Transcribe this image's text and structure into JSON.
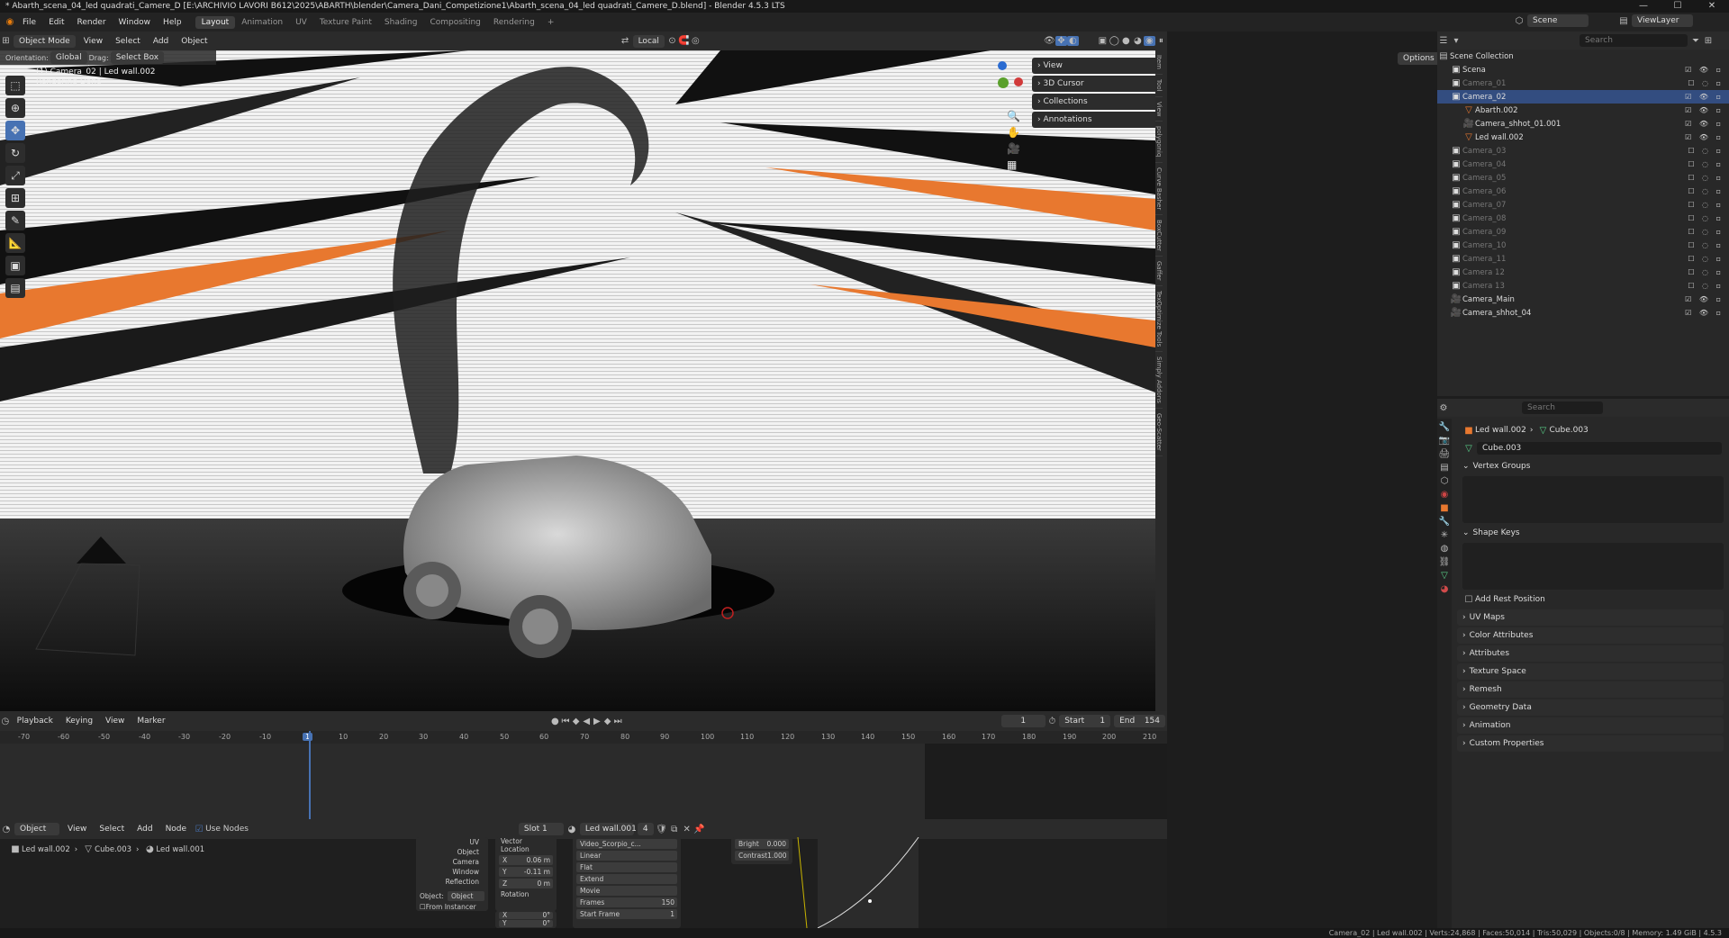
{
  "window": {
    "title": "* Abarth_scena_04_led quadrati_Camere_D [E:\\ARCHIVIO LAVORI B612\\2025\\ABARTH\\blender\\Camera_Dani_Competizione1\\Abarth_scena_04_led quadrati_Camere_D.blend] - Blender 4.5.3 LTS",
    "controls": [
      "—",
      "☐",
      "✕"
    ]
  },
  "menu": {
    "items": [
      "File",
      "Edit",
      "Render",
      "Window",
      "Help"
    ],
    "workspaces": [
      "Layout",
      "Animation",
      "UV",
      "Texture Paint",
      "Shading",
      "Compositing",
      "Rendering"
    ],
    "active_workspace": "Layout",
    "scene_label": "Scene",
    "viewlayer_label": "ViewLayer"
  },
  "viewport": {
    "mode": "Object Mode",
    "menus": [
      "View",
      "Select",
      "Add",
      "Object"
    ],
    "transform_space": "Local",
    "orientation_label": "Orientation:",
    "orientation_value": "Global",
    "drag_label": "Drag:",
    "drag_value": "Select Box",
    "options": "Options",
    "overlay_line1": "Camera Perspective",
    "overlay_line2": "(1) Camera_02 | Led wall.002",
    "overlay_line3": "Rendering Done"
  },
  "npanel": {
    "sections": [
      "View",
      "3D Cursor",
      "Collections",
      "Annotations"
    ],
    "tabs": [
      "Item",
      "Tool",
      "View",
      "polygoniq",
      "Curve Basher",
      "BoxCutter",
      "Gaffer",
      "TexOptimize Tools",
      "Simply Addons",
      "Geo-Scatter"
    ]
  },
  "outliner": {
    "search_placeholder": "Search",
    "root": "Scene Collection",
    "rows": [
      {
        "label": "Scena",
        "indent": 1,
        "dim": false,
        "sel": false,
        "type": "collection"
      },
      {
        "label": "Camera_01",
        "indent": 1,
        "dim": true,
        "sel": false,
        "type": "collection"
      },
      {
        "label": "Camera_02",
        "indent": 1,
        "dim": false,
        "sel": true,
        "type": "collection"
      },
      {
        "label": "Abarth.002",
        "indent": 2,
        "dim": false,
        "sel": false,
        "type": "object"
      },
      {
        "label": "Camera_shhot_01.001",
        "indent": 2,
        "dim": false,
        "sel": false,
        "type": "camera"
      },
      {
        "label": "Led wall.002",
        "indent": 2,
        "dim": false,
        "sel": false,
        "type": "object"
      },
      {
        "label": "Camera_03",
        "indent": 1,
        "dim": true,
        "sel": false,
        "type": "collection"
      },
      {
        "label": "Camera_04",
        "indent": 1,
        "dim": true,
        "sel": false,
        "type": "collection"
      },
      {
        "label": "Camera_05",
        "indent": 1,
        "dim": true,
        "sel": false,
        "type": "collection"
      },
      {
        "label": "Camera_06",
        "indent": 1,
        "dim": true,
        "sel": false,
        "type": "collection"
      },
      {
        "label": "Camera_07",
        "indent": 1,
        "dim": true,
        "sel": false,
        "type": "collection"
      },
      {
        "label": "Camera_08",
        "indent": 1,
        "dim": true,
        "sel": false,
        "type": "collection"
      },
      {
        "label": "Camera_09",
        "indent": 1,
        "dim": true,
        "sel": false,
        "type": "collection"
      },
      {
        "label": "Camera_10",
        "indent": 1,
        "dim": true,
        "sel": false,
        "type": "collection"
      },
      {
        "label": "Camera_11",
        "indent": 1,
        "dim": true,
        "sel": false,
        "type": "collection"
      },
      {
        "label": "Camera 12",
        "indent": 1,
        "dim": true,
        "sel": false,
        "type": "collection"
      },
      {
        "label": "Camera 13",
        "indent": 1,
        "dim": true,
        "sel": false,
        "type": "collection"
      },
      {
        "label": "Camera_Main",
        "indent": 1,
        "dim": false,
        "sel": false,
        "type": "camera"
      },
      {
        "label": "Camera_shhot_04",
        "indent": 1,
        "dim": false,
        "sel": false,
        "type": "camera"
      }
    ]
  },
  "properties": {
    "search_placeholder": "Search",
    "breadcrumb_object": "Led wall.002",
    "breadcrumb_mesh": "Cube.003",
    "mesh_name": "Cube.003",
    "vertex_groups": "Vertex Groups",
    "shape_keys": "Shape Keys",
    "add_rest_position": "Add Rest Position",
    "sections": [
      "UV Maps",
      "Color Attributes",
      "Attributes",
      "Texture Space",
      "Remesh",
      "Geometry Data",
      "Animation",
      "Custom Properties"
    ]
  },
  "timeline": {
    "menus": [
      "Playback",
      "Keying",
      "View",
      "Marker"
    ],
    "current_frame": "1",
    "start_label": "Start",
    "start": "1",
    "end_label": "End",
    "end": "154",
    "ticks": [
      "-70",
      "-60",
      "-50",
      "-40",
      "-30",
      "-20",
      "-10",
      "1",
      "10",
      "20",
      "30",
      "40",
      "50",
      "60",
      "70",
      "80",
      "90",
      "100",
      "110",
      "120",
      "130",
      "140",
      "150",
      "160",
      "170",
      "180",
      "190",
      "200",
      "210"
    ]
  },
  "node_editor": {
    "mode": "Object",
    "menus": [
      "View",
      "Select",
      "Add",
      "Node"
    ],
    "use_nodes": "Use Nodes",
    "slot": "Slot 1",
    "material": "Led wall.001",
    "users": "4",
    "breadcrumb": [
      "Led wall.002",
      "Cube.003",
      "Led wall.001"
    ],
    "texcoord": {
      "outputs": [
        "UV",
        "Object",
        "Camera",
        "Window",
        "Reflection"
      ],
      "object_label": "Object:",
      "object_placeholder": "Object",
      "from_instancer": "From Instancer"
    },
    "mapping": {
      "vector": "Vector",
      "location": "Location",
      "loc_x_label": "X",
      "loc_x": "0.06 m",
      "loc_y_label": "Y",
      "loc_y": "-0.11 m",
      "loc_z_label": "Z",
      "loc_z": "0 m",
      "rotation": "Rotation",
      "rot_x_label": "X",
      "rot_x": "0°",
      "rot_y_label": "Y",
      "rot_y": "0°"
    },
    "image": {
      "name": "Video_Scorpio_c...",
      "interp": "Linear",
      "proj": "Flat",
      "ext": "Extend",
      "source": "Movie",
      "frames_label": "Frames",
      "frames": "150",
      "start_label": "Start Frame",
      "start": "1"
    },
    "bc": {
      "bright_label": "Bright",
      "bright": "0.000",
      "contrast_label": "Contrast",
      "contrast": "1.000"
    }
  },
  "status": "Camera_02 | Led wall.002 | Verts:24,868 | Faces:50,014 | Tris:50,029 | Objects:0/8 | Memory: 1.49 GiB | 4.5.3",
  "colors": {
    "accent": "#4772b3",
    "orange": "#e8782f",
    "selected": "#334d80"
  }
}
